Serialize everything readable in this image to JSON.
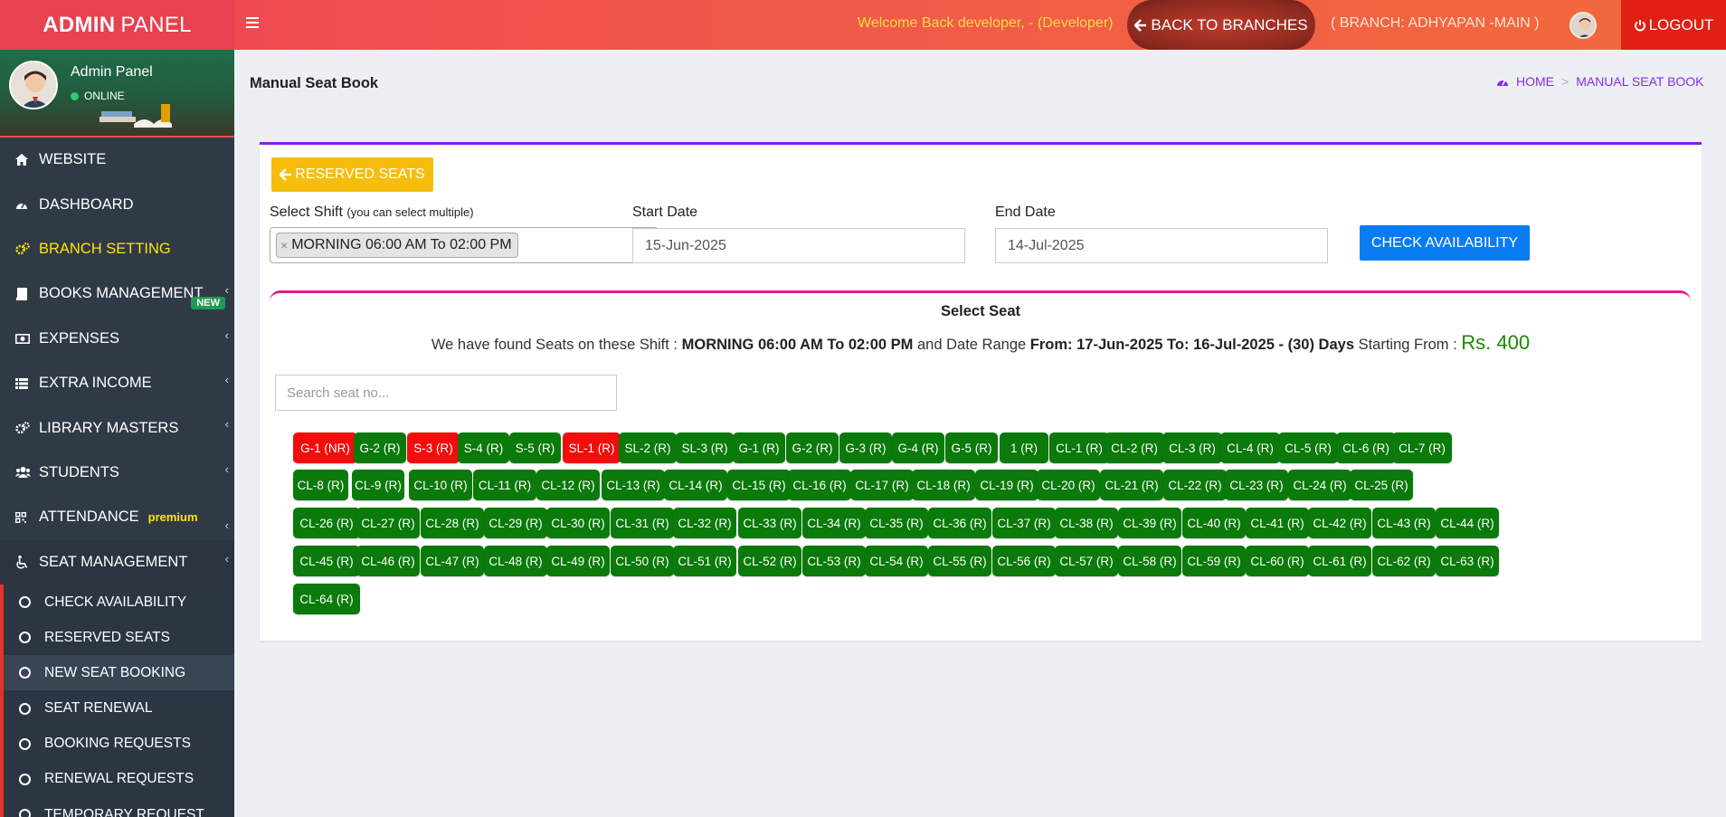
{
  "header": {
    "logo_bold": "ADMIN",
    "logo_rest": "PANEL",
    "welcome": "Welcome Back developer, - (Developer)",
    "back_button": "BACK TO BRANCHES",
    "branch": "( BRANCH: ADHYAPAN -MAIN )",
    "logout": "LOGOUT"
  },
  "user": {
    "name": "Admin Panel",
    "status": "ONLINE"
  },
  "sidebar": {
    "items": [
      {
        "label": "WEBSITE",
        "icon": "home-icon"
      },
      {
        "label": "DASHBOARD",
        "icon": "dashboard-icon"
      },
      {
        "label": "BRANCH SETTING",
        "icon": "gears-icon"
      },
      {
        "label": "BOOKS MANAGEMENT",
        "icon": "book-icon",
        "badge": "NEW"
      },
      {
        "label": "EXPENSES",
        "icon": "money-icon"
      },
      {
        "label": "EXTRA INCOME",
        "icon": "list-icon"
      },
      {
        "label": "LIBRARY MASTERS",
        "icon": "gears-icon"
      },
      {
        "label": "STUDENTS",
        "icon": "users-icon"
      },
      {
        "label": "ATTENDANCE",
        "icon": "qrcode-icon",
        "tag": "premium"
      },
      {
        "label": "SEAT MANAGEMENT",
        "icon": "wheelchair-icon"
      }
    ],
    "submenu": [
      "CHECK AVAILABILITY",
      "RESERVED SEATS",
      "NEW SEAT BOOKING",
      "SEAT RENEWAL",
      "BOOKING REQUESTS",
      "RENEWAL REQUESTS",
      "TEMPORARY REQUEST"
    ]
  },
  "page": {
    "title": "Manual Seat Book",
    "breadcrumb_home": "HOME",
    "breadcrumb_current": "MANUAL SEAT BOOK"
  },
  "form": {
    "reserved_button": "RESERVED SEATS",
    "shift_label": "Select Shift",
    "shift_hint": "(you can select multiple)",
    "shift_selected": "MORNING 06:00 AM To 02:00 PM",
    "start_label": "Start Date",
    "start_value": "15-Jun-2025",
    "end_label": "End Date",
    "end_value": "14-Jul-2025",
    "check_button": "CHECK AVAILABILITY"
  },
  "result": {
    "title": "Select Seat",
    "text1": "We have found Seats on these Shift : ",
    "shift": "MORNING 06:00 AM To 02:00 PM",
    "text2": " and Date Range ",
    "range": "From: 17-Jun-2025 To: 16-Jul-2025 - (30) Days",
    "text3": " Starting From : ",
    "price": "Rs. 400",
    "search_placeholder": "Search seat no..."
  },
  "colors": {
    "available": "#0a7a0a",
    "unavailable": "#f20d0d",
    "accent": "#8a1ce8"
  },
  "seats": [
    {
      "label": "G-1 (NR)",
      "status": "unavailable"
    },
    {
      "label": "G-2 (R)",
      "status": "available"
    },
    {
      "label": "S-3 (R)",
      "status": "unavailable"
    },
    {
      "label": "S-4 (R)",
      "status": "available"
    },
    {
      "label": "S-5 (R)",
      "status": "available"
    },
    {
      "label": "SL-1 (R)",
      "status": "unavailable"
    },
    {
      "label": "SL-2 (R)",
      "status": "available"
    },
    {
      "label": "SL-3 (R)",
      "status": "available"
    },
    {
      "label": "G-1 (R)",
      "status": "available"
    },
    {
      "label": "G-2 (R)",
      "status": "available"
    },
    {
      "label": "G-3 (R)",
      "status": "available"
    },
    {
      "label": "G-4 (R)",
      "status": "available"
    },
    {
      "label": "G-5 (R)",
      "status": "available"
    },
    {
      "label": "1 (R)",
      "status": "available"
    },
    {
      "label": "CL-1 (R)",
      "status": "available"
    },
    {
      "label": "CL-2 (R)",
      "status": "available"
    },
    {
      "label": "CL-3 (R)",
      "status": "available"
    },
    {
      "label": "CL-4 (R)",
      "status": "available"
    },
    {
      "label": "CL-5 (R)",
      "status": "available"
    },
    {
      "label": "CL-6 (R)",
      "status": "available"
    },
    {
      "label": "CL-7 (R)",
      "status": "available"
    },
    {
      "label": "CL-8 (R)",
      "status": "available"
    },
    {
      "label": "CL-9 (R)",
      "status": "available"
    },
    {
      "label": "CL-10 (R)",
      "status": "available"
    },
    {
      "label": "CL-11 (R)",
      "status": "available"
    },
    {
      "label": "CL-12 (R)",
      "status": "available"
    },
    {
      "label": "CL-13 (R)",
      "status": "available"
    },
    {
      "label": "CL-14 (R)",
      "status": "available"
    },
    {
      "label": "CL-15 (R)",
      "status": "available"
    },
    {
      "label": "CL-16 (R)",
      "status": "available"
    },
    {
      "label": "CL-17 (R)",
      "status": "available"
    },
    {
      "label": "CL-18 (R)",
      "status": "available"
    },
    {
      "label": "CL-19 (R)",
      "status": "available"
    },
    {
      "label": "CL-20 (R)",
      "status": "available"
    },
    {
      "label": "CL-21 (R)",
      "status": "available"
    },
    {
      "label": "CL-22 (R)",
      "status": "available"
    },
    {
      "label": "CL-23 (R)",
      "status": "available"
    },
    {
      "label": "CL-24 (R)",
      "status": "available"
    },
    {
      "label": "CL-25 (R)",
      "status": "available"
    },
    {
      "label": "CL-26 (R)",
      "status": "available"
    },
    {
      "label": "CL-27 (R)",
      "status": "available"
    },
    {
      "label": "CL-28 (R)",
      "status": "available"
    },
    {
      "label": "CL-29 (R)",
      "status": "available"
    },
    {
      "label": "CL-30 (R)",
      "status": "available"
    },
    {
      "label": "CL-31 (R)",
      "status": "available"
    },
    {
      "label": "CL-32 (R)",
      "status": "available"
    },
    {
      "label": "CL-33 (R)",
      "status": "available"
    },
    {
      "label": "CL-34 (R)",
      "status": "available"
    },
    {
      "label": "CL-35 (R)",
      "status": "available"
    },
    {
      "label": "CL-36 (R)",
      "status": "available"
    },
    {
      "label": "CL-37 (R)",
      "status": "available"
    },
    {
      "label": "CL-38 (R)",
      "status": "available"
    },
    {
      "label": "CL-39 (R)",
      "status": "available"
    },
    {
      "label": "CL-40 (R)",
      "status": "available"
    },
    {
      "label": "CL-41 (R)",
      "status": "available"
    },
    {
      "label": "CL-42 (R)",
      "status": "available"
    },
    {
      "label": "CL-43 (R)",
      "status": "available"
    },
    {
      "label": "CL-44 (R)",
      "status": "available"
    },
    {
      "label": "CL-45 (R)",
      "status": "available"
    },
    {
      "label": "CL-46 (R)",
      "status": "available"
    },
    {
      "label": "CL-47 (R)",
      "status": "available"
    },
    {
      "label": "CL-48 (R)",
      "status": "available"
    },
    {
      "label": "CL-49 (R)",
      "status": "available"
    },
    {
      "label": "CL-50 (R)",
      "status": "available"
    },
    {
      "label": "CL-51 (R)",
      "status": "available"
    },
    {
      "label": "CL-52 (R)",
      "status": "available"
    },
    {
      "label": "CL-53 (R)",
      "status": "available"
    },
    {
      "label": "CL-54 (R)",
      "status": "available"
    },
    {
      "label": "CL-55 (R)",
      "status": "available"
    },
    {
      "label": "CL-56 (R)",
      "status": "available"
    },
    {
      "label": "CL-57 (R)",
      "status": "available"
    },
    {
      "label": "CL-58 (R)",
      "status": "available"
    },
    {
      "label": "CL-59 (R)",
      "status": "available"
    },
    {
      "label": "CL-60 (R)",
      "status": "available"
    },
    {
      "label": "CL-61 (R)",
      "status": "available"
    },
    {
      "label": "CL-62 (R)",
      "status": "available"
    },
    {
      "label": "CL-63 (R)",
      "status": "available"
    },
    {
      "label": "CL-64 (R)",
      "status": "available"
    }
  ]
}
